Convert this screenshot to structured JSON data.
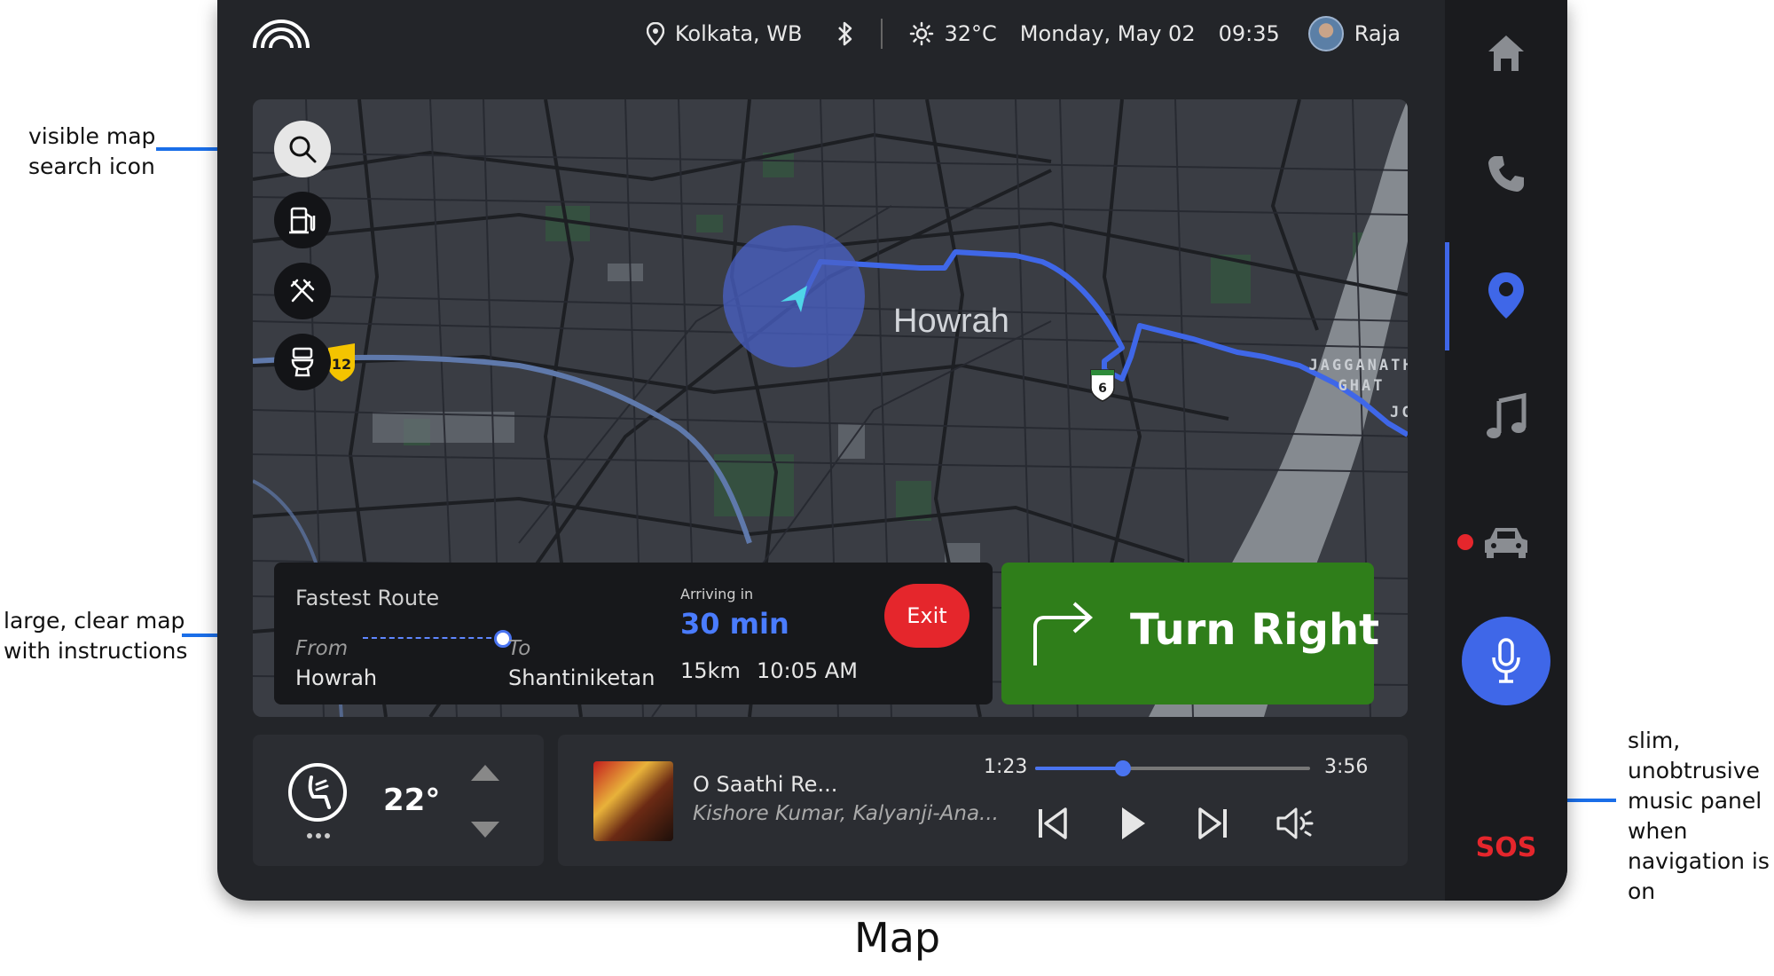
{
  "status_bar": {
    "location": "Kolkata, WB",
    "weather_temp": "32°C",
    "date": "Monday, May 02",
    "time": "09:35",
    "user_name": "Raja"
  },
  "map": {
    "city_label": "Howrah",
    "place_label_line1": "JAGGANATH",
    "place_label_line2": "GHAT",
    "place_label_partial": "JC",
    "shield_left": "12",
    "shield_right": "6",
    "route_color": "#3f67e8"
  },
  "route": {
    "heading": "Fastest Route",
    "from_label": "From",
    "from_value": "Howrah",
    "to_label": "To",
    "to_value": "Shantiniketan",
    "arriving_label": "Arriving in",
    "arriving_value": "30 min",
    "distance": "15km",
    "eta_time": "10:05 AM",
    "exit_label": "Exit"
  },
  "instruction": {
    "text": "Turn Right",
    "color": "#2f7e1a"
  },
  "climate": {
    "temperature": "22°"
  },
  "music": {
    "song": "O Saathi Re...",
    "artist": "Kishore Kumar, Kalyanji-Ana...",
    "current_time": "1:23",
    "total_time": "3:56",
    "progress_fraction": 0.32
  },
  "sidebar": {
    "items": [
      "home-icon",
      "phone-icon",
      "location-pin-icon",
      "music-note-icon",
      "car-icon"
    ],
    "sos_label": "SOS",
    "accent": "#3f67e8"
  },
  "annotations": {
    "search_line1": "visible map",
    "search_line2": "search icon",
    "map_line1": "large, clear map",
    "map_line2": "with instructions",
    "music_line1": "slim,",
    "music_line2": "unobtrusive",
    "music_line3": "music panel",
    "music_line4": "when",
    "music_line5": "navigation is",
    "music_line6": "on"
  },
  "caption": "Map"
}
